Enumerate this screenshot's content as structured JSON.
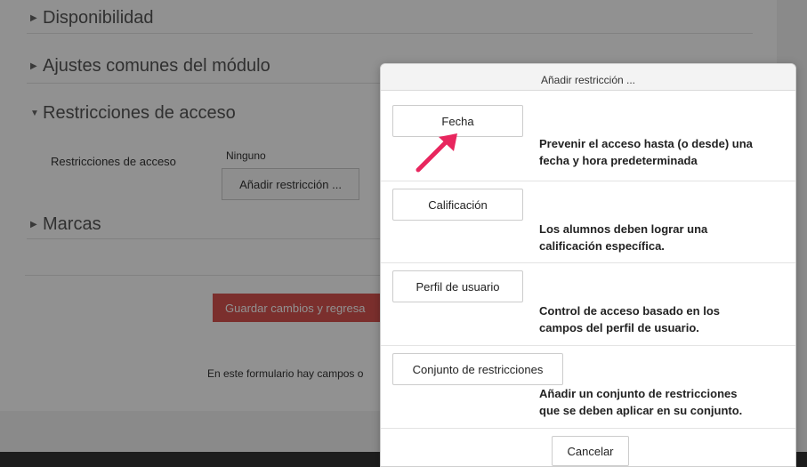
{
  "background": {
    "sections": {
      "disponibilidad": "Disponibilidad",
      "ajustes": "Ajustes comunes del módulo",
      "restricciones": "Restricciones de acceso",
      "marcas": "Marcas"
    },
    "restriction_label": "Restricciones de acceso",
    "restriction_value": "Ninguno",
    "add_restriction_button": "Añadir restricción ...",
    "save_button": "Guardar cambios y regresa",
    "form_note": "En este formulario hay campos o"
  },
  "dialog": {
    "title": "Añadir restricción ...",
    "options": [
      {
        "button": "Fecha",
        "description_line1": "Prevenir el acceso hasta (o desde) una",
        "description_line2": "fecha y hora predeterminada"
      },
      {
        "button": "Calificación",
        "description_line1": "Los alumnos deben lograr una",
        "description_line2": "calificación específica."
      },
      {
        "button": "Perfil de usuario",
        "description_line1": "Control de acceso basado en los",
        "description_line2": "campos del perfil de usuario."
      },
      {
        "button": "Conjunto de restricciones",
        "description_line1": "Añadir un conjunto de restricciones",
        "description_line2": "que se deben aplicar en su conjunto."
      }
    ],
    "cancel_button": "Cancelar"
  },
  "colors": {
    "save_button": "#d9534f",
    "annotation_arrow": "#e8265e",
    "overlay": "rgba(0,0,0,0.43)"
  },
  "icons": {
    "collapsed": "triangle-right-icon",
    "expanded": "triangle-down-icon",
    "annotation": "pointer-arrow-icon"
  }
}
